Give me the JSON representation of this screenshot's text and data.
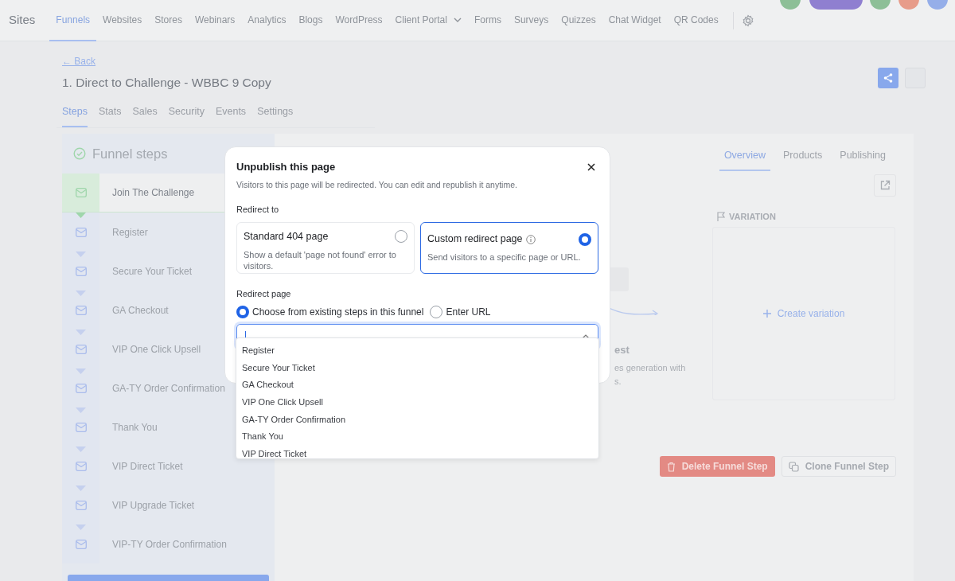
{
  "nav": {
    "brand": "Sites",
    "items": [
      {
        "label": "Funnels",
        "selected": true,
        "caret": false
      },
      {
        "label": "Websites",
        "selected": false,
        "caret": false
      },
      {
        "label": "Stores",
        "selected": false,
        "caret": false
      },
      {
        "label": "Webinars",
        "selected": false,
        "caret": false
      },
      {
        "label": "Analytics",
        "selected": false,
        "caret": false
      },
      {
        "label": "Blogs",
        "selected": false,
        "caret": false
      },
      {
        "label": "WordPress",
        "selected": false,
        "caret": false
      },
      {
        "label": "Client Portal",
        "selected": false,
        "caret": true
      },
      {
        "label": "Forms",
        "selected": false,
        "caret": false
      },
      {
        "label": "Surveys",
        "selected": false,
        "caret": false
      },
      {
        "label": "Quizzes",
        "selected": false,
        "caret": false
      },
      {
        "label": "Chat Widget",
        "selected": false,
        "caret": false
      },
      {
        "label": "QR Codes",
        "selected": false,
        "caret": false
      }
    ]
  },
  "header": {
    "back": "← Back",
    "title": "1. Direct to Challenge - WBBC 9 Copy"
  },
  "tabs": [
    {
      "label": "Steps",
      "selected": true
    },
    {
      "label": "Stats",
      "selected": false
    },
    {
      "label": "Sales",
      "selected": false
    },
    {
      "label": "Security",
      "selected": false
    },
    {
      "label": "Events",
      "selected": false
    },
    {
      "label": "Settings",
      "selected": false
    }
  ],
  "funnel_steps": {
    "title": "Funnel steps",
    "steps": [
      {
        "name": "Join The Challenge",
        "selected": true
      },
      {
        "name": "Register",
        "selected": false
      },
      {
        "name": "Secure Your Ticket",
        "selected": false
      },
      {
        "name": "GA Checkout",
        "selected": false
      },
      {
        "name": "VIP One Click Upsell",
        "selected": false
      },
      {
        "name": "GA-TY Order Confirmation",
        "selected": false
      },
      {
        "name": "Thank You",
        "selected": false
      },
      {
        "name": "VIP Direct Ticket",
        "selected": false
      },
      {
        "name": "VIP Upgrade Ticket",
        "selected": false
      },
      {
        "name": "VIP-TY Order Confirmation",
        "selected": false
      }
    ]
  },
  "step_panel": {
    "tabs": [
      {
        "label": "Overview",
        "selected": true
      },
      {
        "label": "Products",
        "selected": false
      },
      {
        "label": "Publishing",
        "selected": false
      }
    ],
    "hidden_texts": [
      "est",
      "es generation with",
      "s."
    ],
    "variation": {
      "label": "VARIATION",
      "action": "Create variation"
    },
    "buttons": [
      {
        "label": "Delete Funnel Step",
        "kind": "danger"
      },
      {
        "label": "Clone Funnel Step",
        "kind": "outline"
      }
    ]
  },
  "modal": {
    "title": "Unpublish this page",
    "subtitle": "Visitors to this page will be redirected. You can edit and republish it anytime.",
    "redirect_label": "Redirect to",
    "options": [
      {
        "title": "Standard 404 page",
        "description": "Show a default 'page not found' error to visitors.",
        "selected": false,
        "info": false
      },
      {
        "title": "Custom redirect page",
        "description": "Send visitors to a specific page or URL.",
        "selected": true,
        "info": true
      }
    ],
    "redirect_page_label": "Redirect page",
    "sources": [
      {
        "label": "Choose from existing steps in this funnel",
        "selected": true
      },
      {
        "label": "Enter URL",
        "selected": false
      }
    ],
    "dropdown": {
      "expanded": true,
      "options": [
        "Register",
        "Secure Your Ticket",
        "GA Checkout",
        "VIP One Click Upsell",
        "GA-TY Order Confirmation",
        "Thank You",
        "VIP Direct Ticket"
      ]
    }
  }
}
